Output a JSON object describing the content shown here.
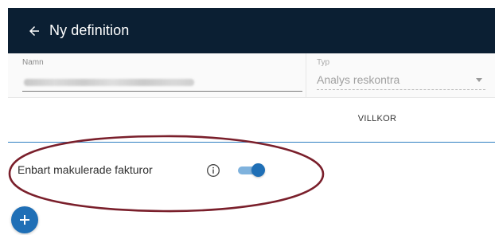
{
  "header": {
    "back_icon": "arrow-left-icon",
    "title": "Ny definition",
    "background": "#0b1f33"
  },
  "form": {
    "name_label": "Namn",
    "name_value": "",
    "type_label": "Typ",
    "type_value": "Analys reskontra"
  },
  "tabs": {
    "villkor_label": "VILLKOR",
    "underline_color": "#2f7fc1"
  },
  "condition": {
    "label": "Enbart makulerade fakturor",
    "info_icon": "info-circle-icon",
    "toggle_on": true,
    "toggle_color": "#1f6fb6"
  },
  "fab": {
    "icon": "plus-icon",
    "color": "#1f6fb6"
  },
  "annotation": {
    "shape": "ellipse",
    "color": "#7a1f2b"
  }
}
